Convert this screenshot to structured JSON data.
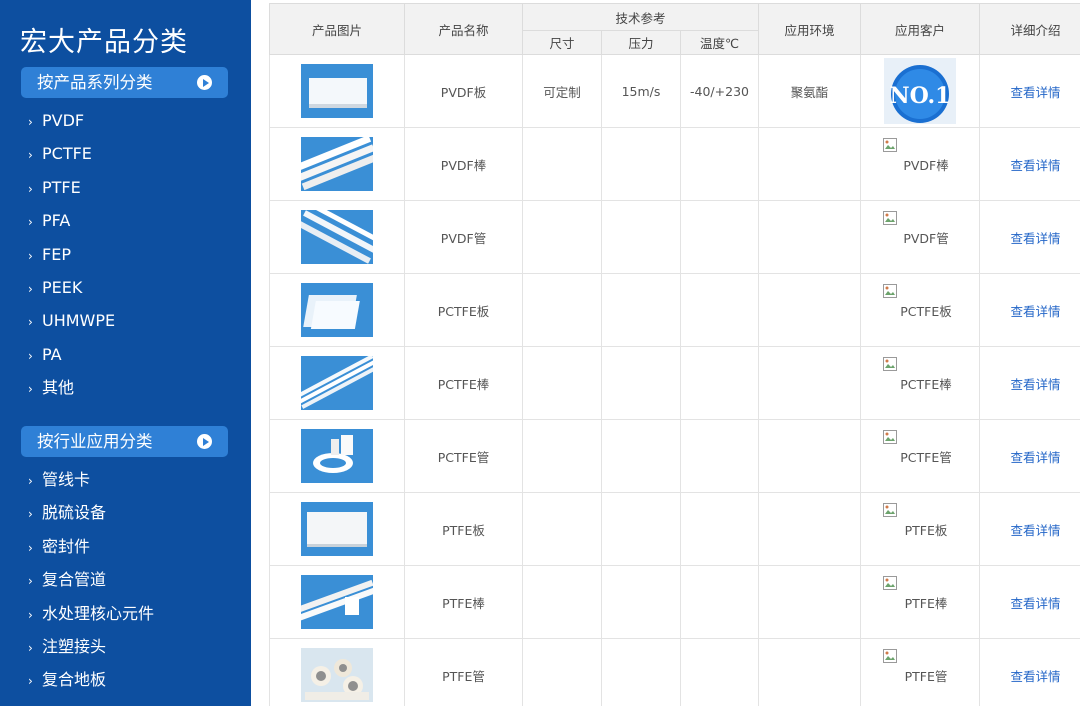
{
  "sidebar": {
    "title": "宏大产品分类",
    "series_header": "按产品系列分类",
    "series_items": [
      "PVDF",
      "PCTFE",
      "PTFE",
      "PFA",
      "FEP",
      "PEEK",
      "UHMWPE",
      "PA",
      "其他"
    ],
    "industry_header": "按行业应用分类",
    "industry_items": [
      "管线卡",
      "脱硫设备",
      "密封件",
      "复合管道",
      "水处理核心元件",
      "注塑接头",
      "复合地板"
    ],
    "arrow_glyph": "›"
  },
  "table": {
    "headers": {
      "image": "产品图片",
      "name": "产品名称",
      "tech": "技术参考",
      "size": "尺寸",
      "pressure": "压力",
      "temperature": "温度℃",
      "environment": "应用环境",
      "customer": "应用客户",
      "detail": "详细介绍"
    },
    "badge_text": "NO.1",
    "rows": [
      {
        "name": "PVDF板",
        "size": "可定制",
        "pressure": "15m/s",
        "temperature": "-40/+230",
        "environment": "聚氨酯",
        "customer": "",
        "detail": "查看详情",
        "image_kind": "sheet"
      },
      {
        "name": "PVDF棒",
        "size": "",
        "pressure": "",
        "temperature": "",
        "environment": "",
        "customer": "PVDF棒",
        "detail": "查看详情",
        "image_kind": "rods"
      },
      {
        "name": "PVDF管",
        "size": "",
        "pressure": "",
        "temperature": "",
        "environment": "",
        "customer": "PVDF管",
        "detail": "查看详情",
        "image_kind": "tubes"
      },
      {
        "name": "PCTFE板",
        "size": "",
        "pressure": "",
        "temperature": "",
        "environment": "",
        "customer": "PCTFE板",
        "detail": "查看详情",
        "image_kind": "plates"
      },
      {
        "name": "PCTFE棒",
        "size": "",
        "pressure": "",
        "temperature": "",
        "environment": "",
        "customer": "PCTFE棒",
        "detail": "查看详情",
        "image_kind": "sticks"
      },
      {
        "name": "PCTFE管",
        "size": "",
        "pressure": "",
        "temperature": "",
        "environment": "",
        "customer": "PCTFE管",
        "detail": "查看详情",
        "image_kind": "rings"
      },
      {
        "name": "PTFE板",
        "size": "",
        "pressure": "",
        "temperature": "",
        "environment": "",
        "customer": "PTFE板",
        "detail": "查看详情",
        "image_kind": "board"
      },
      {
        "name": "PTFE棒",
        "size": "",
        "pressure": "",
        "temperature": "",
        "environment": "",
        "customer": "PTFE棒",
        "detail": "查看详情",
        "image_kind": "bars"
      },
      {
        "name": "PTFE管",
        "size": "",
        "pressure": "",
        "temperature": "",
        "environment": "",
        "customer": "PTFE管",
        "detail": "查看详情",
        "image_kind": "pipes"
      }
    ]
  },
  "colors": {
    "sidebar_bg": "#0d4fa0",
    "header_pill": "#2f80d6",
    "link": "#2567c8",
    "header_bg": "#f2f2f2"
  }
}
